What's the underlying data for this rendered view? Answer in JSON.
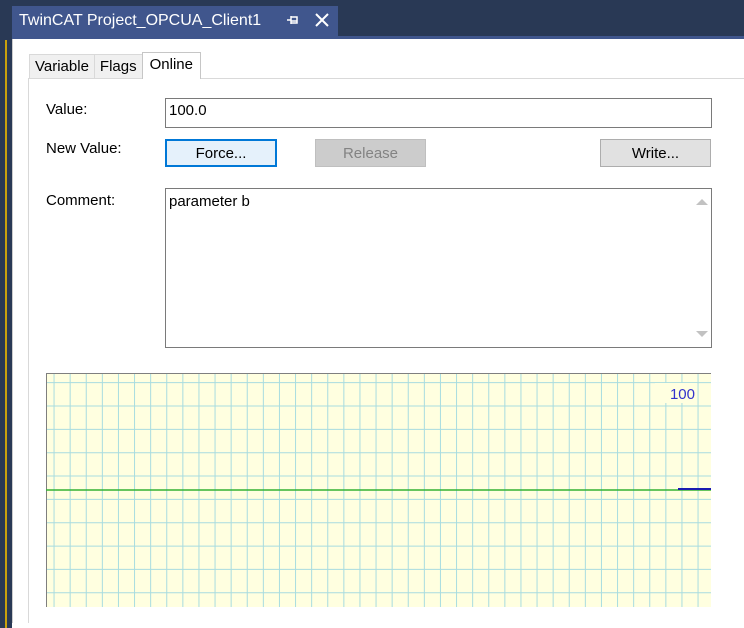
{
  "document_tab": {
    "title": "TwinCAT Project_OPCUA_Client1",
    "pin_icon": "pin-icon",
    "close_icon": "close-icon"
  },
  "tabs": [
    {
      "label": "Variable",
      "active": false
    },
    {
      "label": "Flags",
      "active": false
    },
    {
      "label": "Online",
      "active": true
    }
  ],
  "online": {
    "value_label": "Value:",
    "value": "100.0",
    "new_value_label": "New Value:",
    "force_button": "Force...",
    "release_button": "Release",
    "write_button": "Write...",
    "comment_label": "Comment:",
    "comment": "parameter b"
  },
  "chart_data": {
    "type": "line",
    "series": [
      {
        "values": [
          100
        ]
      }
    ],
    "annotations": [
      "100"
    ],
    "grid": true,
    "colors": {
      "background": "#ffffe0",
      "grid": "#a8dce0",
      "center_line": "#33b233",
      "trace": "#1a1ab0",
      "value_label": "#3333cc"
    }
  },
  "colors": {
    "accent": "#40568d",
    "frame": "#293955"
  }
}
